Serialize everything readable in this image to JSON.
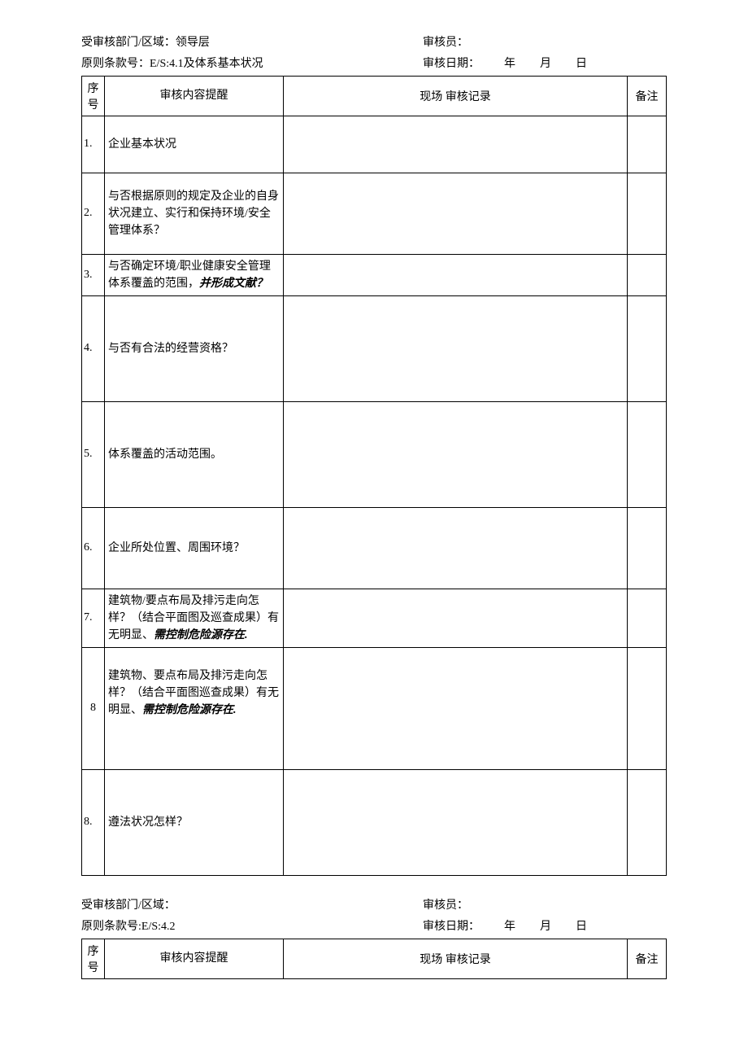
{
  "section1": {
    "header": {
      "dept_label": "受审核部门/区域：",
      "dept_value": "领导层",
      "auditor_label": "审核员：",
      "clause_label": "原则条款号：",
      "clause_value": "E/S:4.1及体系基本状况",
      "date_label": "审核日期：",
      "year": "年",
      "month": "月",
      "day": "日"
    },
    "table": {
      "th_idx": "序号",
      "th_content": "审核内容提醒",
      "th_record": "现场 审核记录",
      "th_note": "备注",
      "rows": [
        {
          "idx": "1.",
          "content": "企业基本状况"
        },
        {
          "idx": "2.",
          "content": "与否根据原则的规定及企业的自身状况建立、实行和保持环境/安全管理体系？"
        },
        {
          "idx": "3.",
          "content_a": "与否确定环境/职业健康安全管理体系覆盖的范围，",
          "content_b": "并形成文献？"
        },
        {
          "idx": "4.",
          "content": "与否有合法的经营资格？"
        },
        {
          "idx": "5.",
          "content": "体系覆盖的活动范围。"
        },
        {
          "idx": "6.",
          "content": "企业所处位置、周围环境？"
        },
        {
          "idx": "7.",
          "content_a": "建筑物/要点布局及排污走向怎样？（结合平面图及巡查成果）有无明显、",
          "content_b": "需控制危险源存在."
        },
        {
          "idx": "8",
          "content_a": "建筑物、要点布局及排污走向怎样？（结合平面图巡查成果）有无明显、",
          "content_b": "需控制危险源存在."
        },
        {
          "idx": "8.",
          "content": "遵法状况怎样？"
        }
      ]
    }
  },
  "section2": {
    "header": {
      "dept_label": "受审核部门/区域：",
      "auditor_label": "审核员：",
      "clause_label": "原则条款号:",
      "clause_value": "E/S:4.2",
      "date_label": "审核日期：",
      "year": "年",
      "month": "月",
      "day": "日"
    },
    "table": {
      "th_idx": "序号",
      "th_content": "审核内容提醒",
      "th_record": "现场 审核记录",
      "th_note": "备注"
    }
  }
}
